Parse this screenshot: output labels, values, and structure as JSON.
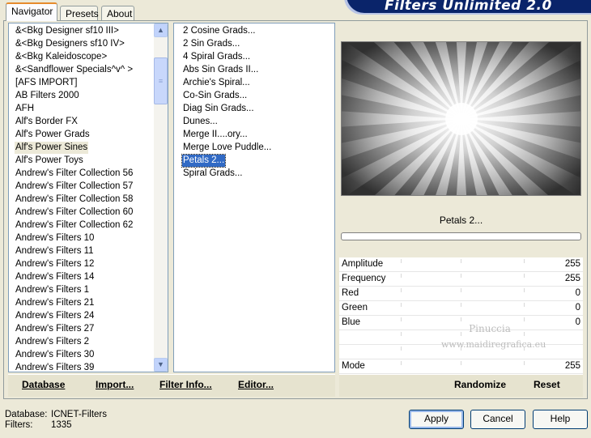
{
  "window": {
    "title": "Filters Unlimited 2.0"
  },
  "tabs": [
    {
      "label": "Navigator",
      "active": true
    },
    {
      "label": "Presets",
      "active": false
    },
    {
      "label": "About",
      "active": false
    }
  ],
  "categories": {
    "items": [
      "&<Bkg Designer sf10 III>",
      "&<Bkg Designers sf10 IV>",
      "&<Bkg Kaleidoscope>",
      "&<Sandflower Specials^v^ >",
      "[AFS IMPORT]",
      "AB Filters 2000",
      "AFH",
      "Alf's Border FX",
      "Alf's Power Grads",
      "Alf's Power Sines",
      "Alf's Power Toys",
      "Andrew's Filter Collection 56",
      "Andrew's Filter Collection 57",
      "Andrew's Filter Collection 58",
      "Andrew's Filter Collection 60",
      "Andrew's Filter Collection 62",
      "Andrew's Filters 10",
      "Andrew's Filters 11",
      "Andrew's Filters 12",
      "Andrew's Filters 14",
      "Andrew's Filters 1",
      "Andrew's Filters 21",
      "Andrew's Filters 24",
      "Andrew's Filters 27",
      "Andrew's Filters 2",
      "Andrew's Filters 30",
      "Andrew's Filters 39"
    ],
    "selected": "Alf's Power Sines"
  },
  "filters": {
    "items": [
      "2 Cosine Grads...",
      "2 Sin Grads...",
      "4 Spiral Grads...",
      "Abs Sin Grads II...",
      "Archie's Spiral...",
      "Co-Sin Grads...",
      "Diag Sin Grads...",
      "Dunes...",
      "Merge II....ory...",
      "Merge Love Puddle...",
      "Petals 2...",
      "Spiral Grads..."
    ],
    "selected": "Petals 2..."
  },
  "preview": {
    "filter_name": "Petals 2..."
  },
  "params": [
    {
      "label": "Amplitude",
      "value": "255"
    },
    {
      "label": "Frequency",
      "value": "255"
    },
    {
      "label": "Red",
      "value": "0"
    },
    {
      "label": "Green",
      "value": "0"
    },
    {
      "label": "Blue",
      "value": "0"
    },
    {
      "label": "",
      "value": ""
    },
    {
      "label": "",
      "value": ""
    },
    {
      "label": "Mode",
      "value": "255"
    }
  ],
  "watermark": {
    "line1": "Pinuccia",
    "line2": "www.maidiregrafica.eu"
  },
  "left_bar": {
    "database": "Database",
    "import": "Import...",
    "filter_info": "Filter Info...",
    "editor": "Editor..."
  },
  "right_bar": {
    "randomize": "Randomize",
    "reset": "Reset"
  },
  "footer": {
    "database_label": "Database:",
    "database_value": "ICNET-Filters",
    "filters_label": "Filters:",
    "filters_value": "1335",
    "apply": "Apply",
    "cancel": "Cancel",
    "help": "Help"
  },
  "colors": {
    "selection": "#316ac5",
    "banner": "#0a246a",
    "panel": "#ece9d8"
  }
}
